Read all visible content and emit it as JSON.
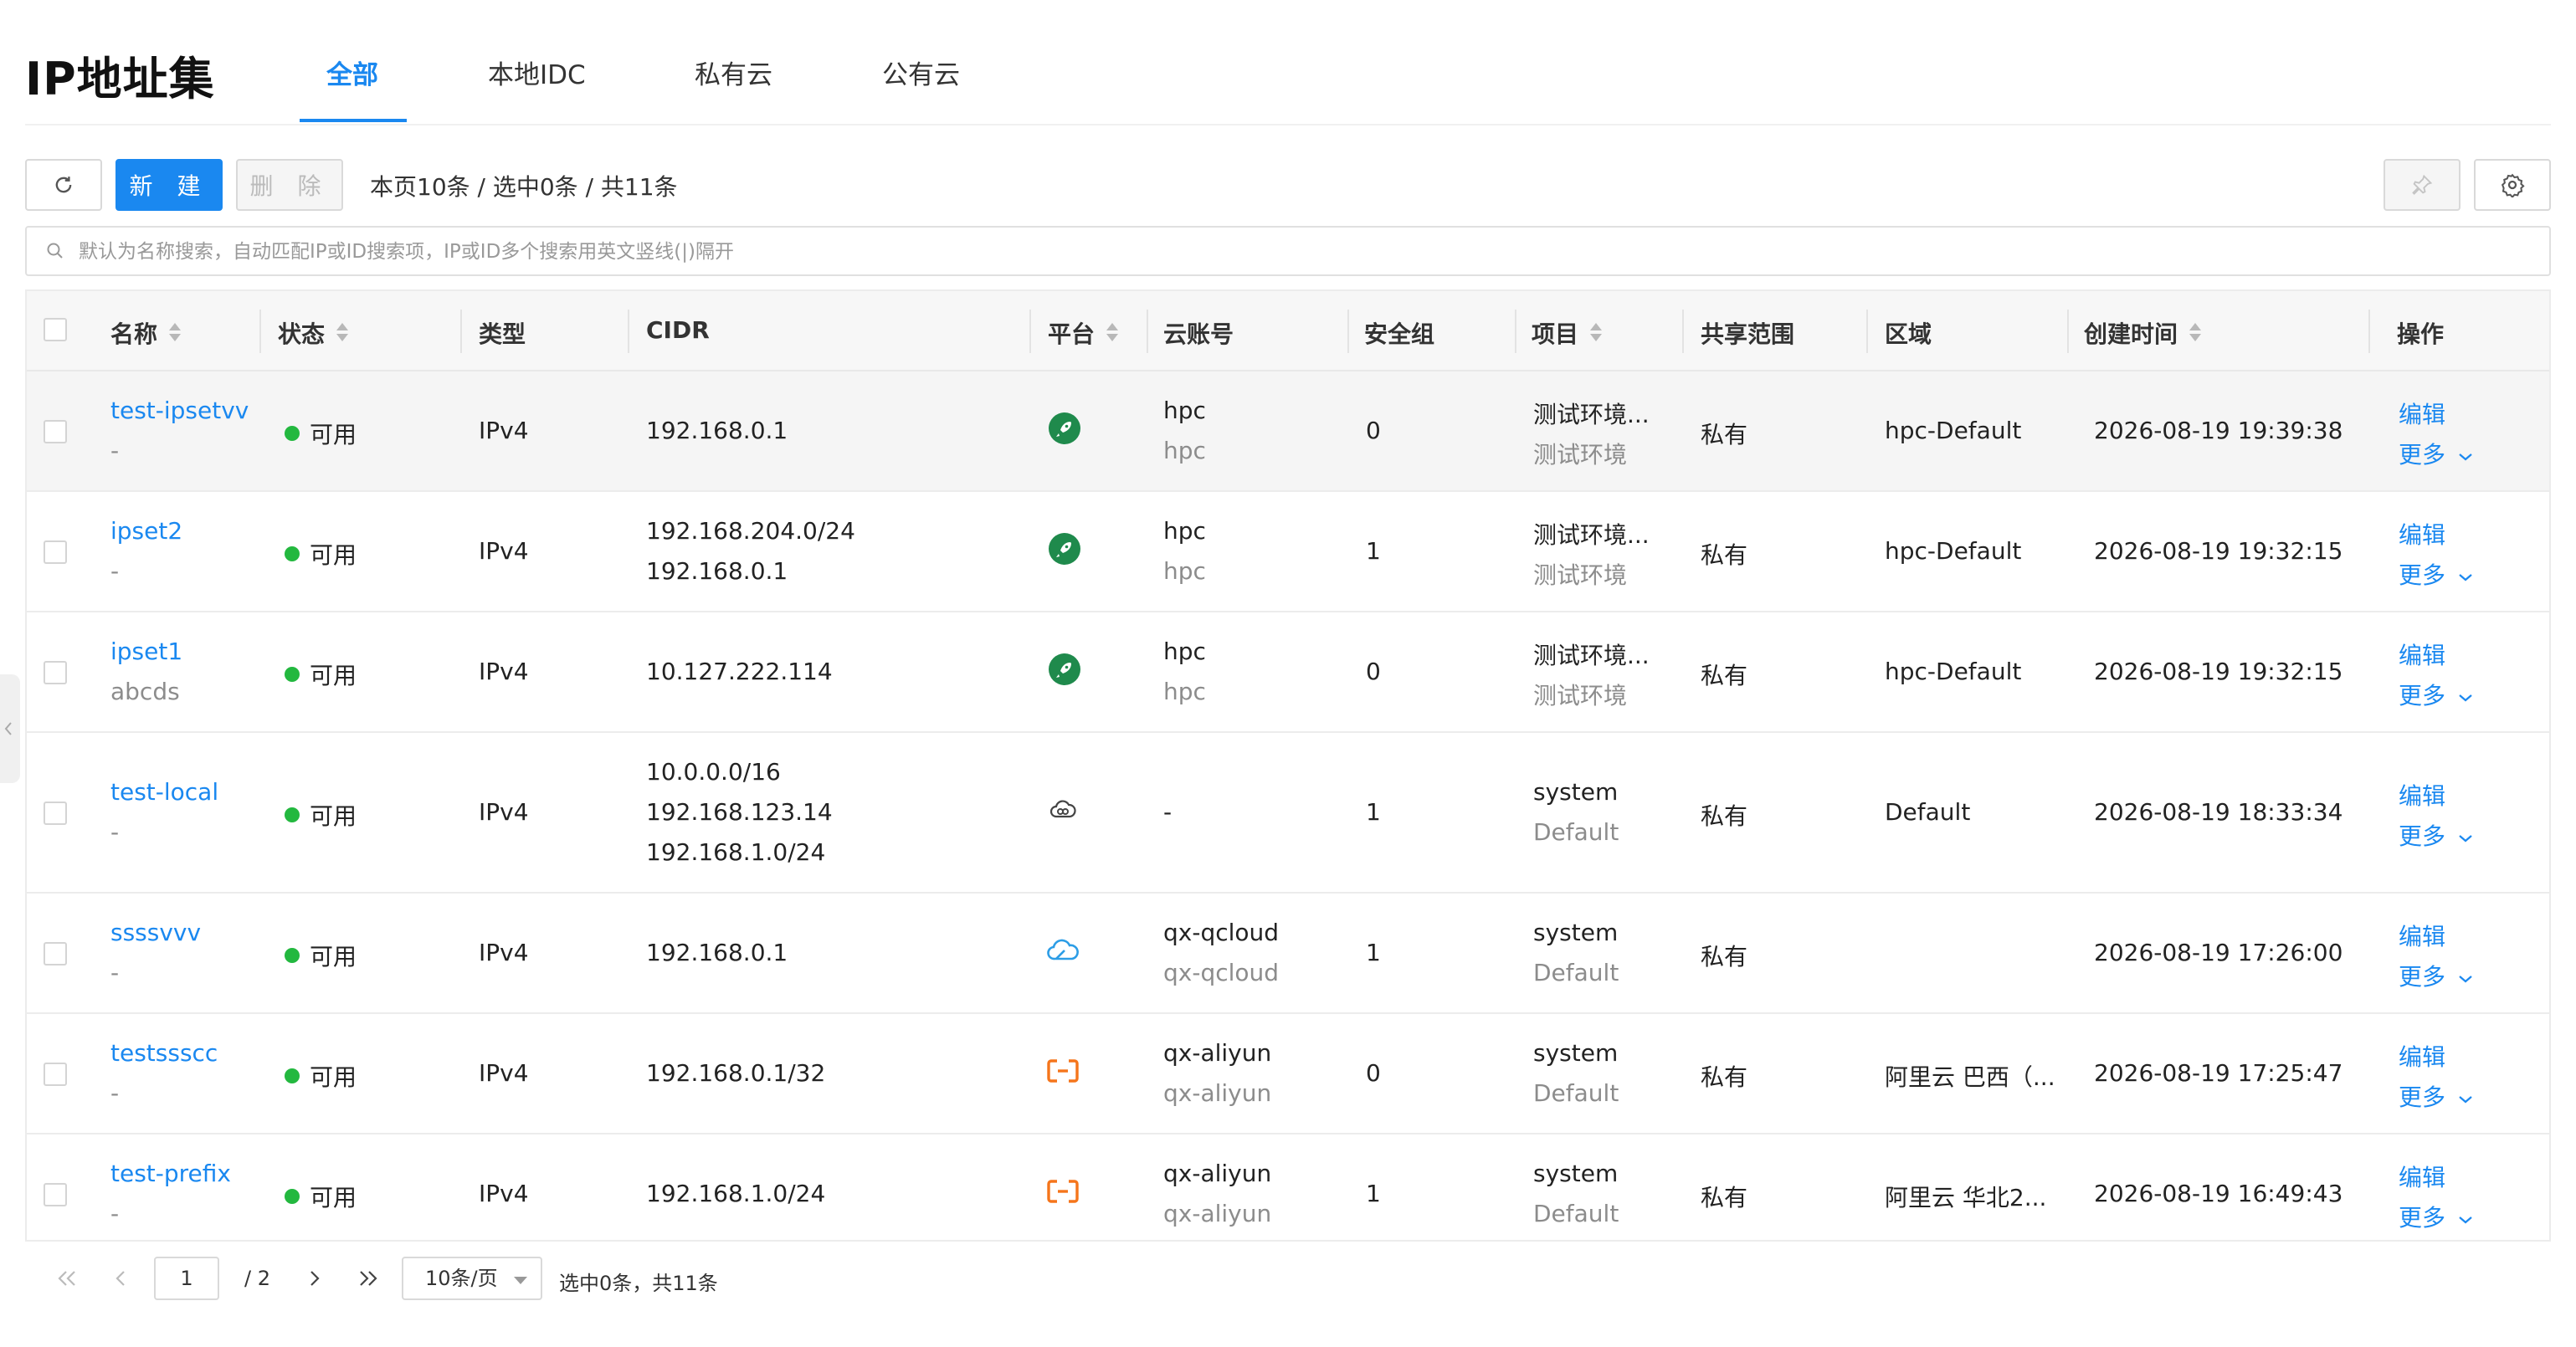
{
  "page_title": "IP地址集",
  "tabs": [
    {
      "label": "全部",
      "active": true
    },
    {
      "label": "本地IDC",
      "active": false
    },
    {
      "label": "私有云",
      "active": false
    },
    {
      "label": "公有云",
      "active": false
    }
  ],
  "toolbar": {
    "refresh_icon": "refresh-icon",
    "new_label": "新 建",
    "delete_label": "删 除",
    "summary": "本页10条 / 选中0条 / 共11条",
    "pin_icon": "pin-icon",
    "settings_icon": "gear-icon"
  },
  "search": {
    "placeholder": "默认为名称搜索，自动匹配IP或ID搜索项，IP或ID多个搜索用英文竖线(|)隔开",
    "icon": "search-icon"
  },
  "table": {
    "columns": [
      {
        "label": "名称",
        "sortable": true
      },
      {
        "label": "状态",
        "sortable": true
      },
      {
        "label": "类型",
        "sortable": false
      },
      {
        "label": "CIDR",
        "sortable": false
      },
      {
        "label": "平台",
        "sortable": true
      },
      {
        "label": "云账号",
        "sortable": false
      },
      {
        "label": "安全组",
        "sortable": false
      },
      {
        "label": "项目",
        "sortable": true
      },
      {
        "label": "共享范围",
        "sortable": false
      },
      {
        "label": "区域",
        "sortable": false
      },
      {
        "label": "创建时间",
        "sortable": true
      },
      {
        "label": "操作",
        "sortable": false
      }
    ],
    "rows": [
      {
        "name": "test-ipsetvv",
        "desc": "-",
        "status": "可用",
        "type": "IPv4",
        "cidr": [
          "192.168.0.1"
        ],
        "platform_icon": "rocket-icon",
        "account": "hpc",
        "account_sub": "hpc",
        "secgroups": "0",
        "project": "测试环境...",
        "project_sub": "测试环境",
        "share": "私有",
        "region": "hpc-Default",
        "created": "2026-08-19 19:39:38",
        "edit": "编辑",
        "more": "更多"
      },
      {
        "name": "ipset2",
        "desc": "-",
        "status": "可用",
        "type": "IPv4",
        "cidr": [
          "192.168.204.0/24",
          "192.168.0.1"
        ],
        "platform_icon": "rocket-icon",
        "account": "hpc",
        "account_sub": "hpc",
        "secgroups": "1",
        "project": "测试环境...",
        "project_sub": "测试环境",
        "share": "私有",
        "region": "hpc-Default",
        "created": "2026-08-19 19:32:15",
        "edit": "编辑",
        "more": "更多"
      },
      {
        "name": "ipset1",
        "desc": "abcds",
        "status": "可用",
        "type": "IPv4",
        "cidr": [
          "10.127.222.114"
        ],
        "platform_icon": "rocket-icon",
        "account": "hpc",
        "account_sub": "hpc",
        "secgroups": "0",
        "project": "测试环境...",
        "project_sub": "测试环境",
        "share": "私有",
        "region": "hpc-Default",
        "created": "2026-08-19 19:32:15",
        "edit": "编辑",
        "more": "更多"
      },
      {
        "name": "test-local",
        "desc": "-",
        "status": "可用",
        "type": "IPv4",
        "cidr": [
          "10.0.0.0/16",
          "192.168.123.14",
          "192.168.1.0/24"
        ],
        "platform_icon": "cloud-link-icon",
        "account": "-",
        "account_sub": "",
        "secgroups": "1",
        "project": "system",
        "project_sub": "Default",
        "share": "私有",
        "region": "Default",
        "created": "2026-08-19 18:33:34",
        "edit": "编辑",
        "more": "更多"
      },
      {
        "name": "ssssvvv",
        "desc": "-",
        "status": "可用",
        "type": "IPv4",
        "cidr": [
          "192.168.0.1"
        ],
        "platform_icon": "qcloud-icon",
        "account": "qx-qcloud",
        "account_sub": "qx-qcloud",
        "secgroups": "1",
        "project": "system",
        "project_sub": "Default",
        "share": "私有",
        "region": "",
        "created": "2026-08-19 17:26:00",
        "edit": "编辑",
        "more": "更多"
      },
      {
        "name": "testssscc",
        "desc": "-",
        "status": "可用",
        "type": "IPv4",
        "cidr": [
          "192.168.0.1/32"
        ],
        "platform_icon": "aliyun-icon",
        "account": "qx-aliyun",
        "account_sub": "qx-aliyun",
        "secgroups": "0",
        "project": "system",
        "project_sub": "Default",
        "share": "私有",
        "region": "阿里云 巴西（...",
        "created": "2026-08-19 17:25:47",
        "edit": "编辑",
        "more": "更多"
      },
      {
        "name": "test-prefix",
        "desc": "-",
        "status": "可用",
        "type": "IPv4",
        "cidr": [
          "192.168.1.0/24"
        ],
        "platform_icon": "aliyun-icon",
        "account": "qx-aliyun",
        "account_sub": "qx-aliyun",
        "secgroups": "1",
        "project": "system",
        "project_sub": "Default",
        "share": "私有",
        "region": "阿里云 华北2...",
        "created": "2026-08-19 16:49:43",
        "edit": "编辑",
        "more": "更多"
      }
    ]
  },
  "pagination": {
    "current_page": "1",
    "total_pages": "/ 2",
    "page_size": "10条/页",
    "summary": "选中0条，共11条"
  },
  "colors": {
    "accent": "#1a88f0",
    "status_ok": "#23b83f",
    "hpc_green": "#1f8a4c",
    "qcloud_blue": "#2c9de6",
    "aliyun_orange": "#f5751b"
  }
}
